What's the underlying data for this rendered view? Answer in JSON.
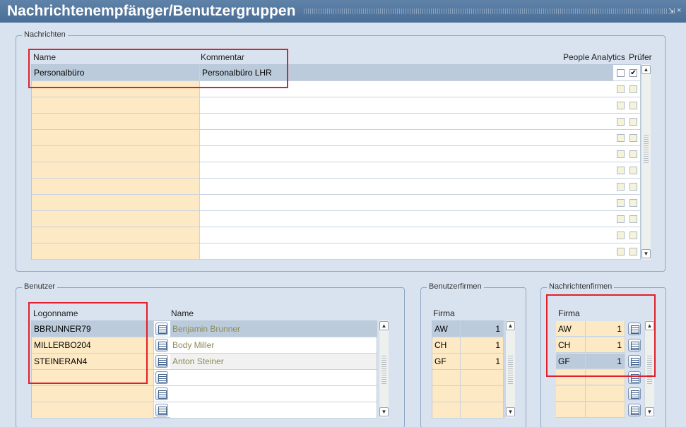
{
  "window": {
    "title": "Nachrichtenempfänger/Benutzergruppen",
    "restore_glyph": "⇲",
    "close_glyph": "×"
  },
  "nachrichten": {
    "legend": "Nachrichten",
    "headers": {
      "name": "Name",
      "kommentar": "Kommentar",
      "people_analytics": "People Analytics",
      "pruefer": "Prüfer"
    },
    "rows": [
      {
        "name": "Personalbüro",
        "kommentar": "Personalbüro LHR",
        "people_analytics": false,
        "pruefer": true
      }
    ],
    "empty_row_count": 11
  },
  "benutzer": {
    "legend": "Benutzer",
    "headers": {
      "logonname": "Logonname",
      "name": "Name"
    },
    "rows": [
      {
        "logonname": "BBRUNNER79",
        "name": "Benjamin Brunner"
      },
      {
        "logonname": "MILLERBO204",
        "name": "Body Miller"
      },
      {
        "logonname": "STEINERAN4",
        "name": "Anton Steiner"
      }
    ],
    "empty_row_count": 3
  },
  "benutzerfirmen": {
    "legend": "Benutzerfirmen",
    "headers": {
      "firma": "Firma"
    },
    "rows": [
      {
        "firma": "AW",
        "value": "1"
      },
      {
        "firma": "CH",
        "value": "1"
      },
      {
        "firma": "GF",
        "value": "1"
      }
    ],
    "empty_row_count": 3
  },
  "nachrichtenfirmen": {
    "legend": "Nachrichtenfirmen",
    "headers": {
      "firma": "Firma"
    },
    "rows": [
      {
        "firma": "AW",
        "value": "1"
      },
      {
        "firma": "CH",
        "value": "1"
      },
      {
        "firma": "GF",
        "value": "1"
      }
    ],
    "empty_row_count": 3
  },
  "icons": {
    "scroll_up": "▲",
    "scroll_down": "▼",
    "check": "✔",
    "lov": "lov-list-icon"
  },
  "colors": {
    "titlebar": "#4a6e97",
    "selected_row": "#bccbdc",
    "required_field": "#fde9c4",
    "highlight": "#e0202a"
  }
}
